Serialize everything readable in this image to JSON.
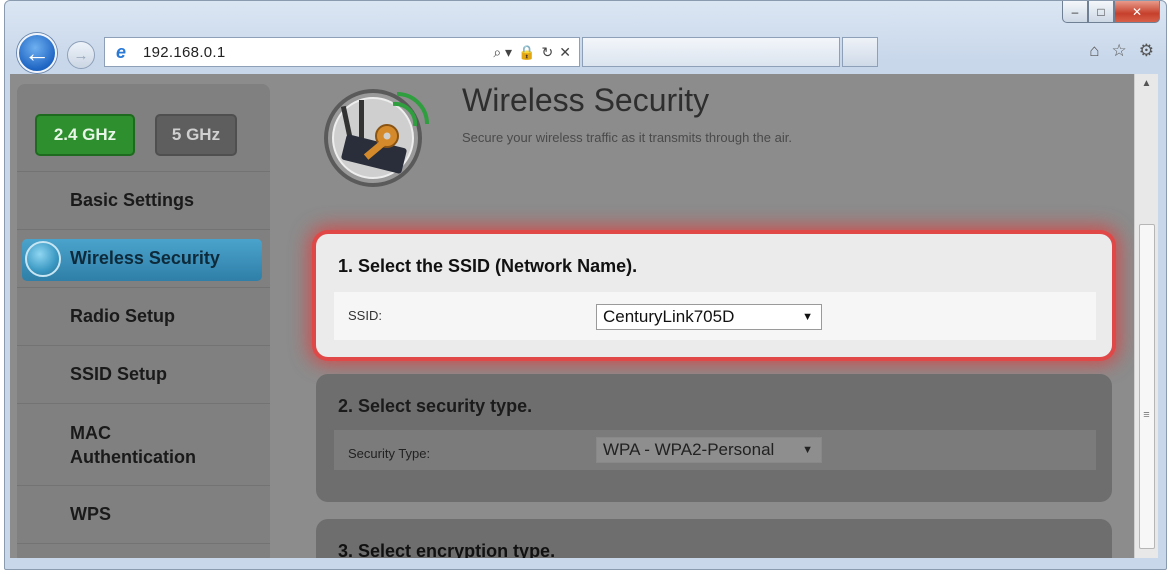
{
  "browser": {
    "url": "192.168.0.1",
    "address_tools": [
      "⌕ ▾",
      "🔒",
      "↻",
      "✕"
    ],
    "window_controls": [
      "–",
      "□",
      "✕"
    ],
    "nav": {
      "back": "←",
      "forward": "→"
    },
    "right_icons": [
      "⌂",
      "☆",
      "⚙"
    ]
  },
  "sidebar": {
    "bands": [
      {
        "label": "2.4 GHz",
        "active": true,
        "color": "#2e8f2e"
      },
      {
        "label": "5 GHz",
        "active": false,
        "color": "#5e5e5e"
      }
    ],
    "items": [
      {
        "label": "Basic Settings"
      },
      {
        "label": "Wireless Security",
        "active": true
      },
      {
        "label": "Radio Setup"
      },
      {
        "label": "SSID Setup"
      },
      {
        "label": "MAC Authentication"
      },
      {
        "label": "WPS"
      }
    ]
  },
  "header": {
    "title": "Wireless Security",
    "subtitle": "Secure your wireless traffic as it transmits through the air."
  },
  "panels": [
    {
      "heading": "1. Select the SSID (Network Name).",
      "field_label": "SSID:",
      "value": "CenturyLink705D",
      "highlight_color": "#e04848"
    },
    {
      "heading": "2. Select security type.",
      "field_label": "Security Type:",
      "value": "WPA - WPA2-Personal"
    },
    {
      "heading": "3. Select encryption type."
    }
  ]
}
